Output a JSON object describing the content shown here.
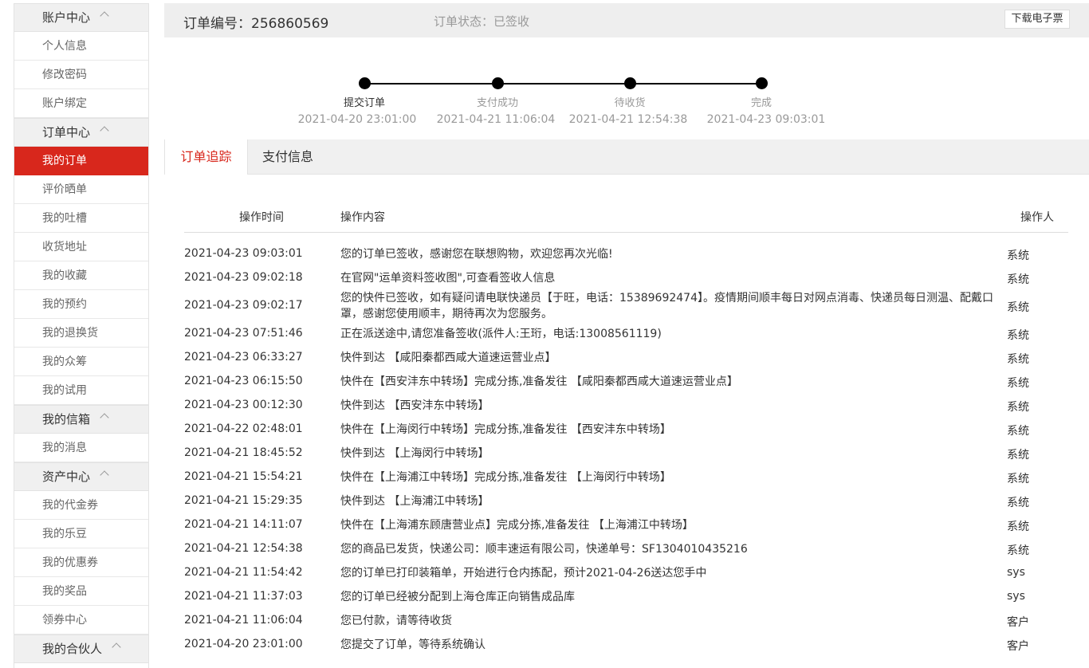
{
  "sidebar": {
    "sections": [
      {
        "title": "账户中心",
        "items": [
          "个人信息",
          "修改密码",
          "账户绑定"
        ]
      },
      {
        "title": "订单中心",
        "items": [
          "我的订单",
          "评价晒单",
          "我的吐槽",
          "收货地址",
          "我的收藏",
          "我的预约",
          "我的退换货",
          "我的众筹",
          "我的试用"
        ]
      },
      {
        "title": "我的信箱",
        "items": [
          "我的消息"
        ]
      },
      {
        "title": "资产中心",
        "items": [
          "我的代金券",
          "我的乐豆",
          "我的优惠券",
          "我的奖品",
          "领券中心"
        ]
      },
      {
        "title": "我的合伙人",
        "items": []
      }
    ],
    "active_item": "我的订单"
  },
  "header": {
    "order_label": "订单编号：256860569",
    "status_label": "订单状态：已签收",
    "download_button": "下载电子票"
  },
  "progress": {
    "steps": [
      {
        "label": "提交订单",
        "time": "2021-04-20 23:01:00",
        "done": true
      },
      {
        "label": "支付成功",
        "time": "2021-04-21 11:06:04",
        "done": false
      },
      {
        "label": "待收货",
        "time": "2021-04-21 12:54:38",
        "done": false
      },
      {
        "label": "完成",
        "time": "2021-04-23 09:03:01",
        "done": false
      }
    ]
  },
  "tabs": [
    {
      "label": "订单追踪",
      "active": true
    },
    {
      "label": "支付信息",
      "active": false
    }
  ],
  "table": {
    "headers": {
      "time": "操作时间",
      "content": "操作内容",
      "operator": "操作人"
    },
    "rows": [
      {
        "time": "2021-04-23 09:03:01",
        "content": "您的订单已签收，感谢您在联想购物，欢迎您再次光临!",
        "operator": "系统"
      },
      {
        "time": "2021-04-23 09:02:18",
        "content": "在官网\"运单资料签收图\",可查看签收人信息",
        "operator": "系统"
      },
      {
        "time": "2021-04-23 09:02:17",
        "content": "您的快件已签收，如有疑问请电联快递员【于旺，电话：15389692474】。疫情期间顺丰每日对网点消毒、快递员每日测温、配戴口罩，感谢您使用顺丰，期待再次为您服务。",
        "operator": "系统"
      },
      {
        "time": "2021-04-23 07:51:46",
        "content": "正在派送途中,请您准备签收(派件人:王珩，电话:13008561119)",
        "operator": "系统"
      },
      {
        "time": "2021-04-23 06:33:27",
        "content": "快件到达 【咸阳秦都西咸大道速运营业点】",
        "operator": "系统"
      },
      {
        "time": "2021-04-23 06:15:50",
        "content": "快件在【西安沣东中转场】完成分拣,准备发往 【咸阳秦都西咸大道速运营业点】",
        "operator": "系统"
      },
      {
        "time": "2021-04-23 00:12:30",
        "content": "快件到达 【西安沣东中转场】",
        "operator": "系统"
      },
      {
        "time": "2021-04-22 02:48:01",
        "content": "快件在【上海闵行中转场】完成分拣,准备发往 【西安沣东中转场】",
        "operator": "系统"
      },
      {
        "time": "2021-04-21 18:45:52",
        "content": "快件到达 【上海闵行中转场】",
        "operator": "系统"
      },
      {
        "time": "2021-04-21 15:54:21",
        "content": "快件在【上海浦江中转场】完成分拣,准备发往 【上海闵行中转场】",
        "operator": "系统"
      },
      {
        "time": "2021-04-21 15:29:35",
        "content": "快件到达 【上海浦江中转场】",
        "operator": "系统"
      },
      {
        "time": "2021-04-21 14:11:07",
        "content": "快件在【上海浦东顾唐营业点】完成分拣,准备发往 【上海浦江中转场】",
        "operator": "系统"
      },
      {
        "time": "2021-04-21 12:54:38",
        "content": "您的商品已发货，快递公司：顺丰速运有限公司，快递单号：SF1304010435216",
        "operator": "系统"
      },
      {
        "time": "2021-04-21 11:54:42",
        "content": "您的订单已打印装箱单，开始进行仓内拣配，预计2021-04-26送达您手中",
        "operator": "sys"
      },
      {
        "time": "2021-04-21 11:37:03",
        "content": "您的订单已经被分配到上海仓库正向销售成品库",
        "operator": "sys"
      },
      {
        "time": "2021-04-21 11:06:04",
        "content": "您已付款，请等待收货",
        "operator": "客户"
      },
      {
        "time": "2021-04-20 23:01:00",
        "content": "您提交了订单，等待系统确认",
        "operator": "客户"
      }
    ]
  },
  "colors": {
    "accent": "#d8271c",
    "header_bg": "#eeeeee",
    "sidebar_section_bg": "#f0f0f0"
  }
}
